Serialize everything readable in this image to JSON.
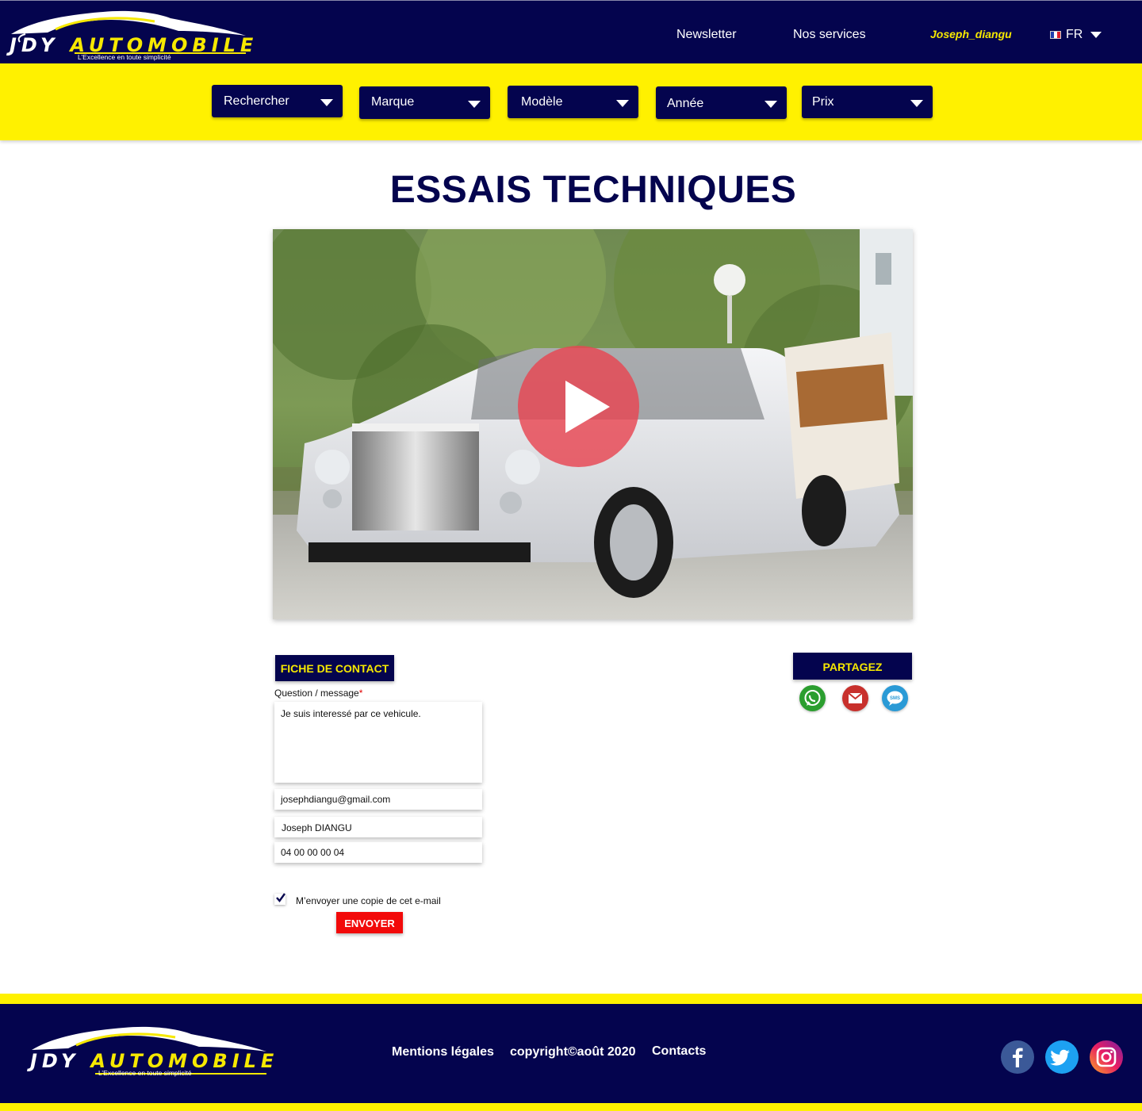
{
  "brand": {
    "logo_initials": "JDY",
    "logo_word": "AUTOMOBILE",
    "tagline": "L’Excellence en toute simplicité",
    "navy": "#04044e",
    "yellow": "#fff100"
  },
  "header": {
    "nav": [
      "Newsletter",
      "Nos services"
    ],
    "user": "Joseph_diangu",
    "language": "FR"
  },
  "filters": [
    "Rechercher",
    "Marque",
    "Modèle",
    "Année",
    "Prix"
  ],
  "page": {
    "title": "ESSAIS TECHNIQUES"
  },
  "contact": {
    "heading": "FICHE DE CONTACT",
    "message_label": "Question / message",
    "required_mark": "*",
    "message_value": "Je suis interessé par ce vehicule.",
    "email_value": "josephdiangu@gmail.com",
    "name_value": "Joseph DIANGU",
    "phone_value": "04 00 00 00 04",
    "copy_label": "M’envoyer une copie de cet e-mail",
    "copy_checked": true,
    "submit_label": "ENVOYER"
  },
  "share": {
    "heading": "PARTAGEZ",
    "icons": [
      "whatsapp-icon",
      "gmail-icon",
      "sms-icon"
    ],
    "sms_text": "SMS"
  },
  "footer": {
    "links": [
      "Mentions légales",
      "copyright©août 2020",
      "Contacts"
    ],
    "social": [
      "facebook-icon",
      "twitter-icon",
      "instagram-icon"
    ]
  }
}
